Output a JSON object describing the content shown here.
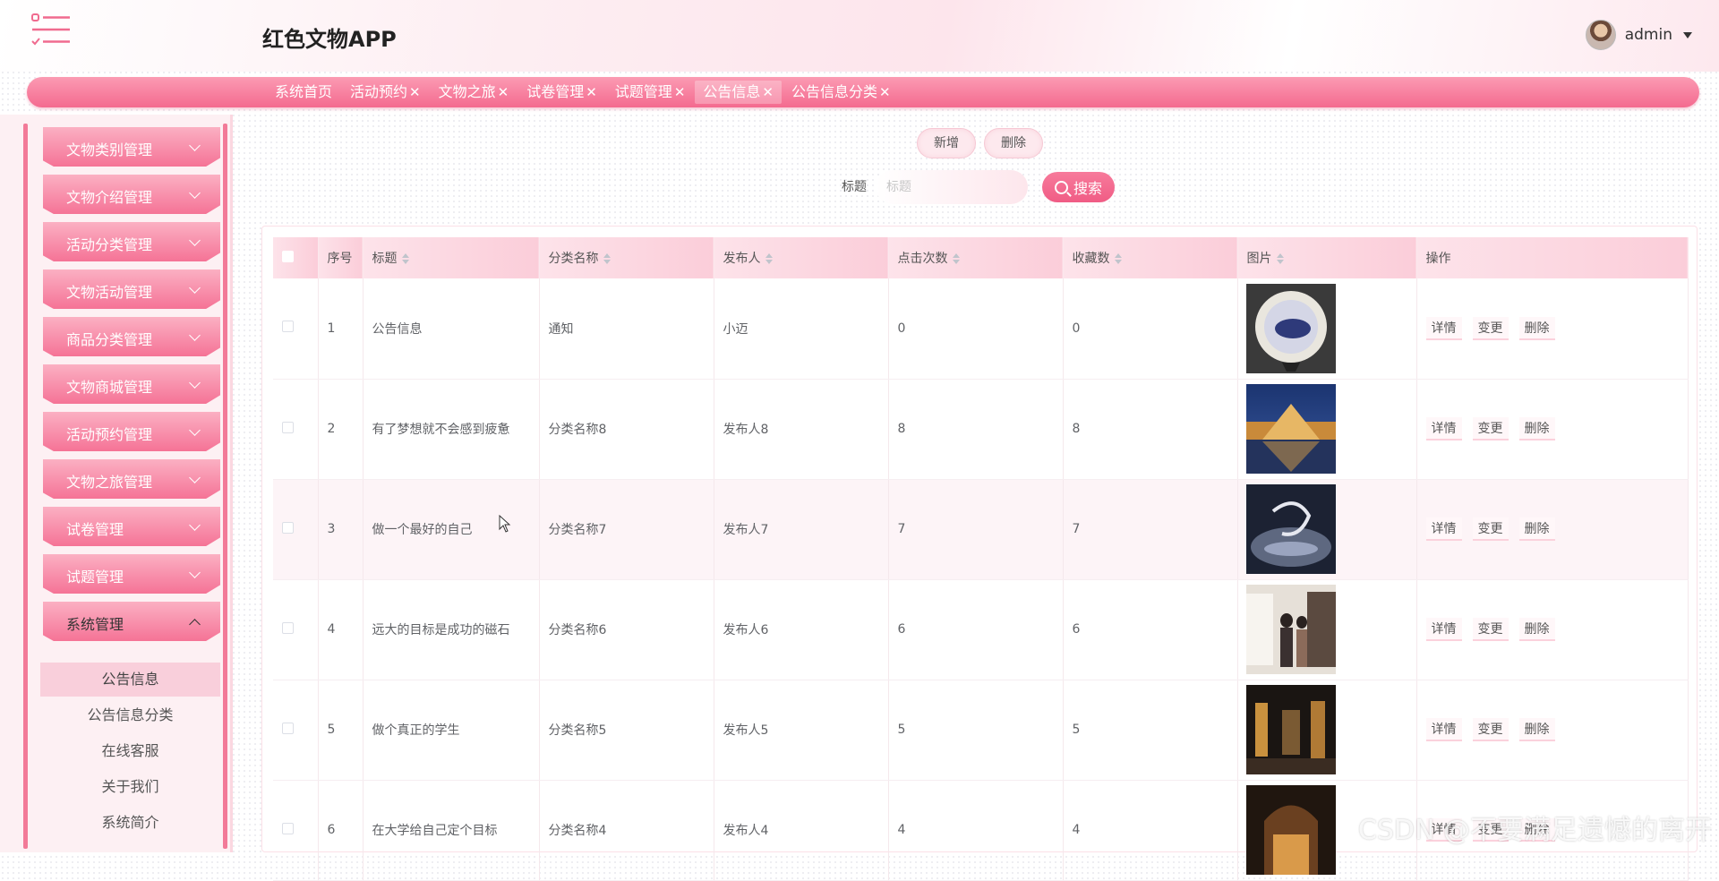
{
  "header": {
    "app_title": "红色文物APP",
    "user_name": "admin"
  },
  "tabs": [
    {
      "label": "系统首页"
    },
    {
      "label": "活动预约",
      "close": "✕"
    },
    {
      "label": "文物之旅",
      "close": "✕"
    },
    {
      "label": "试卷管理",
      "close": "✕"
    },
    {
      "label": "试题管理",
      "close": "✕"
    },
    {
      "label": "公告信息",
      "close": "✕",
      "active": true
    },
    {
      "label": "公告信息分类",
      "close": "✕"
    }
  ],
  "sidebar": {
    "items": [
      {
        "label": "文物类别管理"
      },
      {
        "label": "文物介绍管理"
      },
      {
        "label": "活动分类管理"
      },
      {
        "label": "文物活动管理"
      },
      {
        "label": "商品分类管理"
      },
      {
        "label": "文物商城管理"
      },
      {
        "label": "活动预约管理"
      },
      {
        "label": "文物之旅管理"
      },
      {
        "label": "试卷管理"
      },
      {
        "label": "试题管理"
      },
      {
        "label": "系统管理",
        "open": true
      }
    ],
    "sub_items": [
      {
        "label": "公告信息",
        "active": true
      },
      {
        "label": "公告信息分类"
      },
      {
        "label": "在线客服"
      },
      {
        "label": "关于我们"
      },
      {
        "label": "系统简介"
      }
    ]
  },
  "toolbar": {
    "add_label": "新增",
    "delete_label": "删除",
    "search_label": "标题",
    "search_placeholder": "标题",
    "search_button": "搜索"
  },
  "table": {
    "columns": [
      "序号",
      "标题",
      "分类名称",
      "发布人",
      "点击次数",
      "收藏数",
      "图片",
      "操作"
    ],
    "rows": [
      {
        "no": "1",
        "title": "公告信息",
        "category": "通知",
        "publisher": "小迈",
        "clicks": "0",
        "favorites": "0"
      },
      {
        "no": "2",
        "title": "有了梦想就不会感到疲惫",
        "category": "分类名称8",
        "publisher": "发布人8",
        "clicks": "8",
        "favorites": "8"
      },
      {
        "no": "3",
        "title": "做一个最好的自己",
        "category": "分类名称7",
        "publisher": "发布人7",
        "clicks": "7",
        "favorites": "7"
      },
      {
        "no": "4",
        "title": "远大的目标是成功的磁石",
        "category": "分类名称6",
        "publisher": "发布人6",
        "clicks": "6",
        "favorites": "6"
      },
      {
        "no": "5",
        "title": "做个真正的学生",
        "category": "分类名称5",
        "publisher": "发布人5",
        "clicks": "5",
        "favorites": "5"
      },
      {
        "no": "6",
        "title": "在大学给自己定个目标",
        "category": "分类名称4",
        "publisher": "发布人4",
        "clicks": "4",
        "favorites": "4"
      }
    ],
    "actions": {
      "detail": "详情",
      "edit": "变更",
      "delete": "删除"
    }
  },
  "watermark": "CSDN @不要满足遗憾的离开",
  "colors": {
    "accent": "#f46a8f",
    "accent_light": "#fbb0c3",
    "row_alt": "#fdf4f7"
  }
}
